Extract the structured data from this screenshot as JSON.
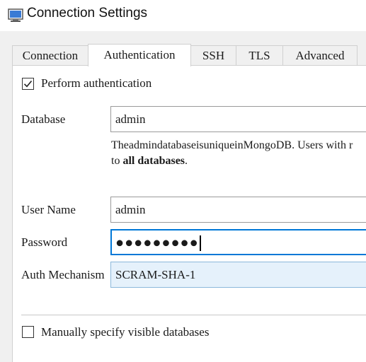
{
  "window": {
    "title": "Connection Settings",
    "icon": "monitor-icon"
  },
  "tabs": [
    {
      "label": "Connection",
      "active": false
    },
    {
      "label": "Authentication",
      "active": true
    },
    {
      "label": "SSH",
      "active": false
    },
    {
      "label": "TLS",
      "active": false
    },
    {
      "label": "Advanced",
      "active": false
    }
  ],
  "auth": {
    "perform_label": "Perform authentication",
    "perform_checked": true,
    "database_label": "Database",
    "database_value": "admin",
    "help_line1": "TheadmindatabaseisuniqueinMongoDB. Users with r",
    "help_line2_prefix": "to ",
    "help_line2_bold": "all databases",
    "help_line2_suffix": ".",
    "username_label": "User Name",
    "username_value": "admin",
    "password_label": "Password",
    "password_mask": "●●●●●●●●●",
    "mechanism_label": "Auth Mechanism",
    "mechanism_value": "SCRAM-SHA-1",
    "manual_label": "Manually specify visible databases",
    "manual_checked": false
  },
  "colors": {
    "focus": "#0078d7",
    "select_bg": "#e5f1fb"
  }
}
